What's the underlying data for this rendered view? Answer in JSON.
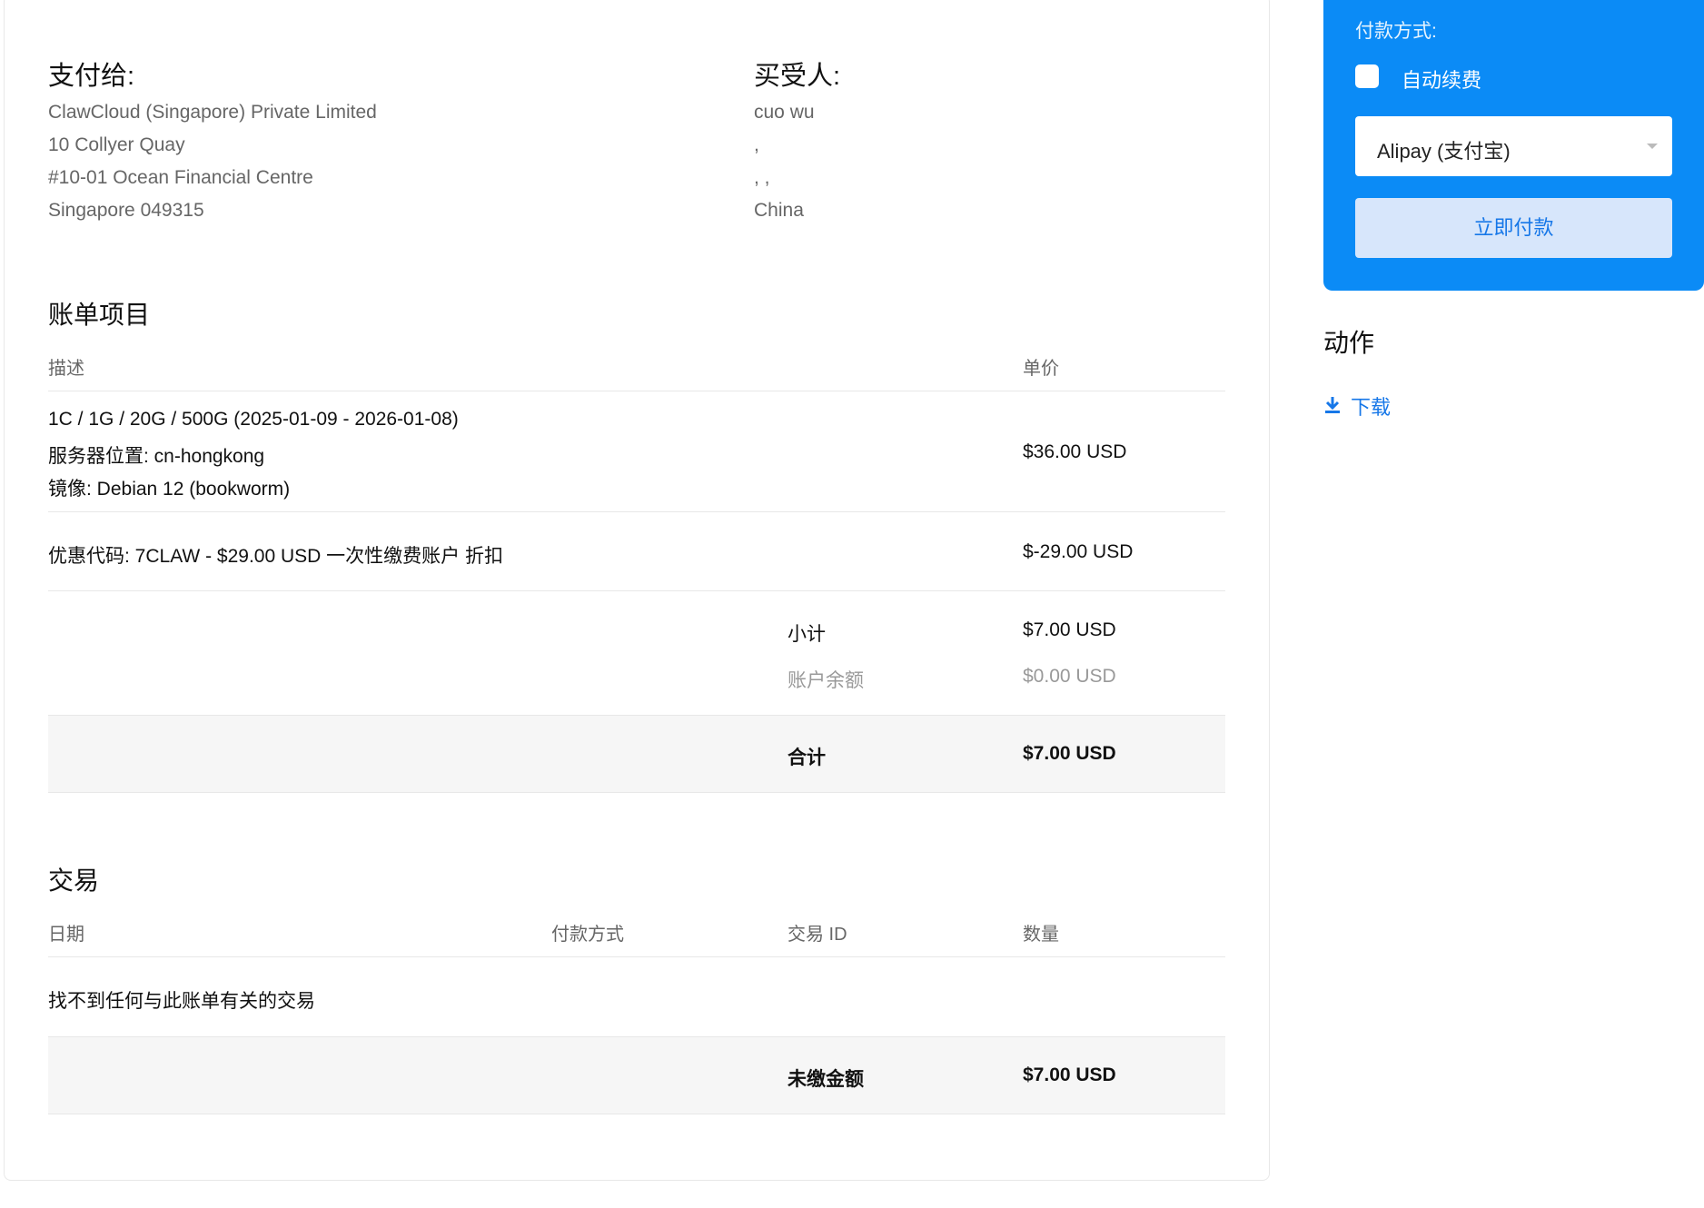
{
  "pay_to": {
    "heading": "支付给:",
    "lines": [
      "ClawCloud (Singapore) Private Limited",
      "10 Collyer Quay",
      "#10-01 Ocean Financial Centre",
      "Singapore 049315"
    ]
  },
  "buyer": {
    "heading": "买受人:",
    "lines": [
      "cuo wu",
      ",",
      ", ,",
      "China"
    ]
  },
  "invoice_items": {
    "title": "账单项目",
    "col_description": "描述",
    "col_price": "单价",
    "rows": [
      {
        "lines": [
          "1C / 1G / 20G / 500G (2025-01-09 - 2026-01-08)",
          "服务器位置: cn-hongkong",
          "镜像: Debian 12 (bookworm)"
        ],
        "price": "$36.00 USD"
      },
      {
        "lines": [
          "优惠代码: 7CLAW - $29.00 USD 一次性缴费账户 折扣"
        ],
        "price": "$-29.00 USD"
      }
    ],
    "subtotal_label": "小计",
    "subtotal_value": "$7.00 USD",
    "credit_label": "账户余额",
    "credit_value": "$0.00 USD",
    "total_label": "合计",
    "total_value": "$7.00 USD"
  },
  "transactions": {
    "title": "交易",
    "col_date": "日期",
    "col_method": "付款方式",
    "col_txn_id": "交易 ID",
    "col_amount": "数量",
    "empty_text": "找不到任何与此账单有关的交易",
    "balance_label": "未缴金额",
    "balance_value": "$7.00 USD"
  },
  "payment_panel": {
    "method_label": "付款方式:",
    "auto_renew_label": "自动续费",
    "auto_renew_checked": false,
    "selected_method": "Alipay (支付宝)",
    "pay_button": "立即付款",
    "panel_color": "#0b8bf6"
  },
  "actions": {
    "title": "动作",
    "download_label": "下载",
    "download_icon": "download-icon"
  }
}
